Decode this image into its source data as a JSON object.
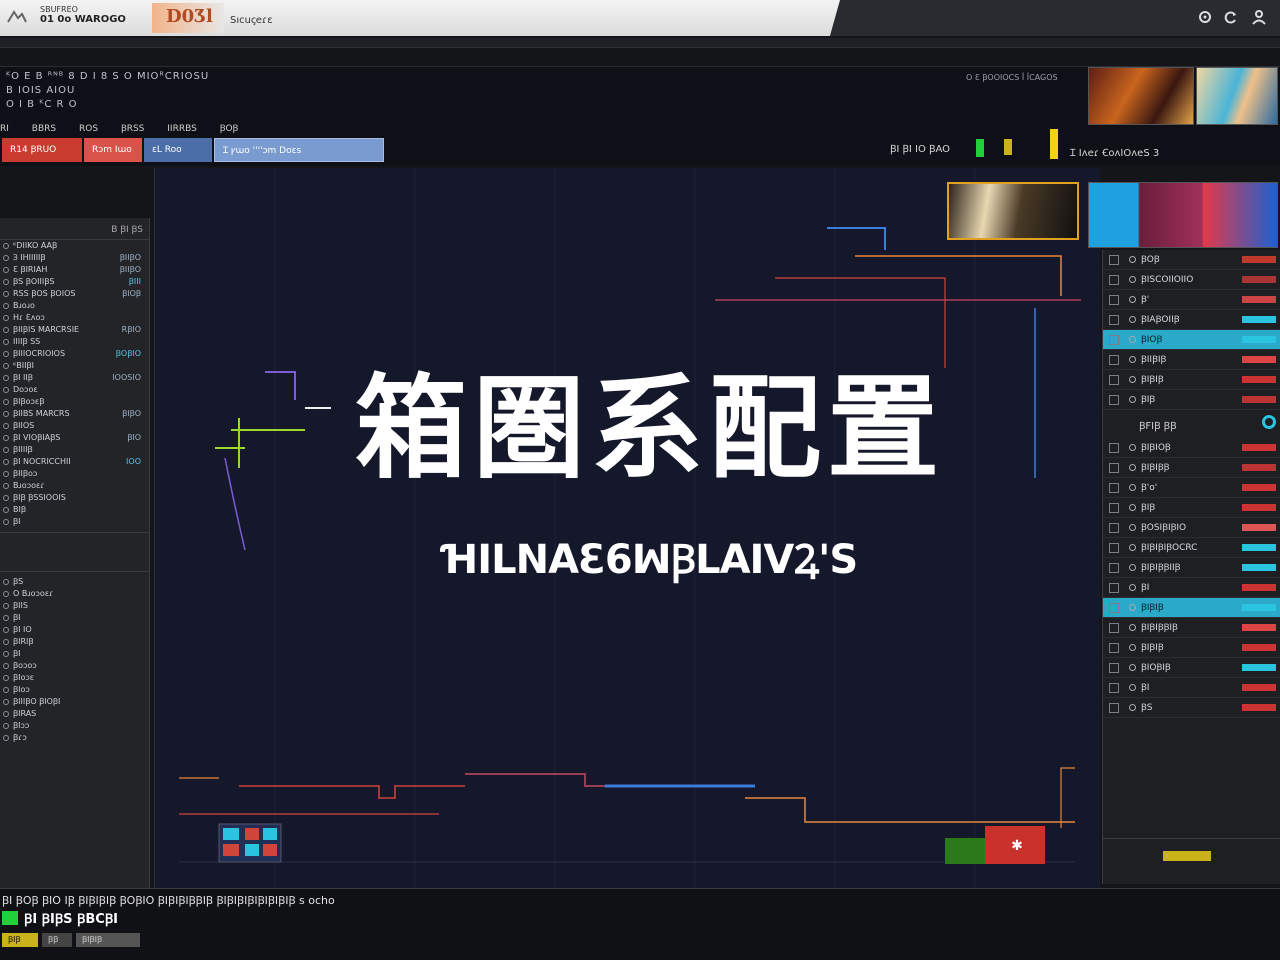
{
  "titlebar": {
    "app_sub": "SBUFREO",
    "app_name": "01 0o WAROGO",
    "logo": "D0Ʒl",
    "menu": "Sıcuꞔeɾε",
    "controls": [
      "settings-icon",
      "refresh-icon",
      "user-icon"
    ]
  },
  "header": {
    "line1": "ᴷO E B  ᴿᴺᴮ  8 D I 8 S  O  MIOᴿCRIOSU",
    "line2": "B IOIS  AIOU",
    "line3": "O I B ᴷC R O",
    "right_info": "O  Ɛ  ꞴOOIOCS  ꟾ ꟾCAGOS",
    "menu": [
      "RI",
      "BBRS",
      "ROS",
      "ꞴRSS",
      "IIRRBS",
      "ꞴOꞴ"
    ],
    "tabs": [
      "R14  ꞴRUO",
      "Rɔm Iɯo",
      "ɛL  Roo",
      "Ɪ   ꝩɯo    ꞌꞌꞌꞌɔm               Doɛs"
    ],
    "status_top": "ꞴI  ꞴI   IO   ꞴAO",
    "status_right": "Ɪ   Iʌeɾ ꞒoʌIOʌeS   3"
  },
  "canvas": {
    "title": "箱圏系配置",
    "subtitle": "ꞪILNAƐ6ꟽꞴLAIVꝜ'S"
  },
  "left_panel": {
    "header": "B ꞴI ꞴS",
    "rows": [
      {
        "label": "ᴷDIIKO  AAꞴ",
        "value": ""
      },
      {
        "label": "Ɜ IHIIIIIꞴ",
        "value": "ꞴIIꞴO"
      },
      {
        "label": "Ɛ  ꞴIRIAH",
        "value": "ꞴIIꞴO"
      },
      {
        "label": "ꞴS  ꞴOIIIꞴS",
        "value": "ꞴIII"
      },
      {
        "label": "RSS  ꞴOS  ꞴOIOS",
        "value": "ꞴIOꞴ"
      },
      {
        "label": "Bɹoɹo",
        "value": ""
      },
      {
        "label": "Hɾ Ɛʌoɔ",
        "value": ""
      },
      {
        "label": "ꞴIIꞴIS  MARCRSIE",
        "value": "RꞴIO"
      },
      {
        "label": "IIIIꞴ SS",
        "value": ""
      },
      {
        "label": "ꞴIIIOCRIOIOS",
        "value": "ꞴOꞴIO"
      },
      {
        "label": "ᴷBIIꞴI",
        "value": ""
      },
      {
        "label": "ꞴI IIꞴ",
        "value": "IOOSIO"
      },
      {
        "label": "Doɔoɛ",
        "value": ""
      },
      {
        "label": "ꞴIꞴoɔɛꞴ",
        "value": ""
      },
      {
        "label": "ꞴIIBS  MARCRS",
        "value": "ꞴIꞴO"
      },
      {
        "label": "ꞴIIOS",
        "value": ""
      },
      {
        "label": "ꞴI   VIOꞴIAꞴS",
        "value": "ꞴIO"
      },
      {
        "label": "ꞴIIIIꞴ",
        "value": ""
      },
      {
        "label": "ꞴI  NOCRICCHII",
        "value": "IOO"
      },
      {
        "label": "ꞴIIꞴoɔ",
        "value": ""
      },
      {
        "label": "Bɹoɔoɛɾ",
        "value": ""
      },
      {
        "label": "ꞴIꞴ   ꞴSSIOOIS",
        "value": ""
      },
      {
        "label": "BIꞴ",
        "value": ""
      },
      {
        "label": "ꞴI",
        "value": ""
      }
    ],
    "rows2": [
      {
        "label": "ꞴS",
        "value": ""
      },
      {
        "label": "O Bɹoɔoɛɾ",
        "value": ""
      },
      {
        "label": "ꞴIIS",
        "value": ""
      },
      {
        "label": "ꞴI",
        "value": ""
      },
      {
        "label": "ꞴI IO",
        "value": ""
      },
      {
        "label": "ꞴIRIꞴ",
        "value": ""
      },
      {
        "label": "ꞴI",
        "value": ""
      },
      {
        "label": "Ꞵoɔoɔ",
        "value": ""
      },
      {
        "label": "ꞴIoɔɛ",
        "value": ""
      },
      {
        "label": "ꞴIoɔ",
        "value": ""
      },
      {
        "label": "ꞴIIIꞴO  ꞴIOꞴI",
        "value": ""
      },
      {
        "label": "ꞴIRAS",
        "value": ""
      },
      {
        "label": "ꞴIɔɔ",
        "value": ""
      },
      {
        "label": "Ꞵɾɔ",
        "value": ""
      }
    ]
  },
  "right_panel": {
    "rows": [
      {
        "label": "ꞴOꞴ",
        "color": "#c0392b",
        "highlight": false
      },
      {
        "label": "ꞴISCOIIOIIO",
        "color": "#a33",
        "highlight": false
      },
      {
        "label": "Ꞵꞌ",
        "color": "#c44",
        "highlight": false
      },
      {
        "label": "ꞴIAꞴOIIꞴ",
        "color": "#2ac4e0",
        "highlight": false
      },
      {
        "label": "ꞴIOꞴ",
        "color": "#2ac4e0",
        "highlight": true
      },
      {
        "label": "ꞴIIꞴIꞴ",
        "color": "#d44",
        "highlight": false
      },
      {
        "label": "ꞴIꞴIꞴ",
        "color": "#c33",
        "highlight": false
      },
      {
        "label": "ꞴIꞴ",
        "color": "#b33",
        "highlight": false
      }
    ],
    "sub": "ꞴFIꞴ   ꞴꞴ",
    "rows2": [
      {
        "label": "ꞴIꞴIOꞴ",
        "color": "#c33",
        "highlight": false
      },
      {
        "label": "ꞴIꞴIꞴꞴ",
        "color": "#b33",
        "highlight": false
      },
      {
        "label": "Ꞵꞌoꞌ",
        "color": "#c33",
        "highlight": false
      },
      {
        "label": "ꞴIꞴ",
        "color": "#c33",
        "highlight": false
      },
      {
        "label": "ꞴOSIꞴIꞴIO",
        "color": "#d55",
        "highlight": false
      },
      {
        "label": "ꞴIꞴIꞴIꞴOCRC",
        "color": "#2ac4e0",
        "highlight": false
      },
      {
        "label": "ꞴIꞴIꞴꞴIIꞴ",
        "color": "#2ac4e0",
        "highlight": false
      },
      {
        "label": "ꞴI",
        "color": "#c33",
        "highlight": false
      },
      {
        "label": "ꞴIꞴIꞴ",
        "color": "#2ac4e0",
        "highlight": true
      },
      {
        "label": "ꞴIꞴIꞴꞴIꞴ",
        "color": "#d44",
        "highlight": false
      },
      {
        "label": "ꞴIꞴIꞴ",
        "color": "#c33",
        "highlight": false
      },
      {
        "label": "ꞴIOꞴIꞴ",
        "color": "#2ac4e0",
        "highlight": false
      },
      {
        "label": "ꞴI",
        "color": "#c33",
        "highlight": false
      },
      {
        "label": "ꞴS",
        "color": "#c33",
        "highlight": false
      }
    ]
  },
  "footer": {
    "line": "ꞴI ꞴOꞴ ꞴIO IꞴ   ꞴIꞴIꞴIꞴ ꞴOꞴIO   ꞴIꞴIꞴIꞴꞴIꞴ ꞴIꞴIꞴIꞴIꞴIꞴIꞴIꞴ s ocho",
    "status": "ꞴI  ꞴIꞴS  ꞴBCꞴI",
    "buttons": [
      "ꞴIꞴ",
      "ꞴꞴ",
      "ꞴIꞴIꞴ"
    ]
  },
  "colors": {
    "canvas_bg": "#15172b",
    "accent_red": "#c83b2e",
    "accent_blue": "#4b6ea8",
    "accent_cyan": "#2aa9c9",
    "accent_green": "#22d13a",
    "accent_yellow": "#f3d11a"
  }
}
